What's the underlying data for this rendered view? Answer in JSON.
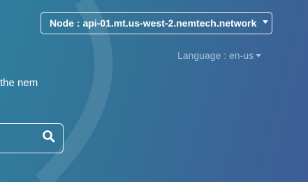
{
  "header": {
    "node_label": "Node : api-01.mt.us-west-2.nemtech.network",
    "language_label": "Language : en-us"
  },
  "hero": {
    "tagline_fragment": "the nem"
  },
  "search": {
    "icon": "search-icon"
  }
}
